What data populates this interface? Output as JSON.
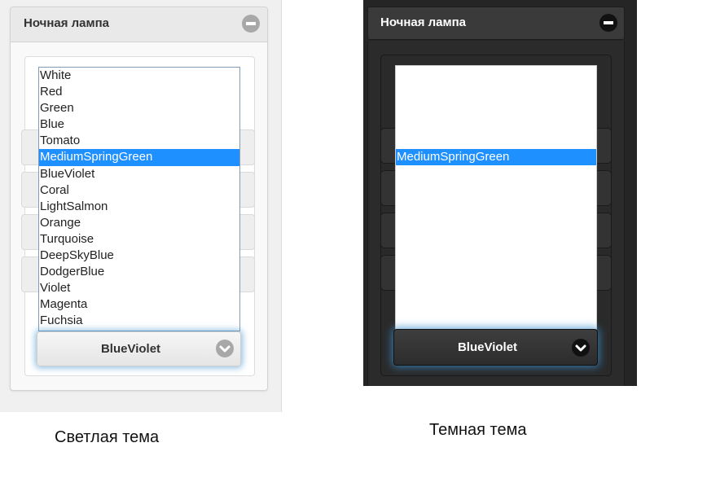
{
  "light_theme": {
    "panel_title": "Ночная лампа",
    "collapse_icon": "minus-circle-icon",
    "options": [
      "White",
      "Red",
      "Green",
      "Blue",
      "Tomato",
      "MediumSpringGreen",
      "BlueViolet",
      "Coral",
      "LightSalmon",
      "Orange",
      "Turquoise",
      "DeepSkyBlue",
      "DodgerBlue",
      "Violet",
      "Magenta",
      "Fuchsia"
    ],
    "highlighted_option": "MediumSpringGreen",
    "select_value": "BlueViolet",
    "select_icon": "chevron-down-icon",
    "caption": "Светлая тема"
  },
  "dark_theme": {
    "panel_title": "Ночная лампа",
    "collapse_icon": "minus-circle-icon",
    "highlighted_option": "MediumSpringGreen",
    "select_value": "BlueViolet",
    "select_icon": "chevron-down-icon",
    "caption": "Темная тема"
  },
  "colors": {
    "highlight": "#1e90ff",
    "focus_glow": "#388ccb",
    "light_background": "#f0f0f0",
    "dark_background": "#252525"
  }
}
